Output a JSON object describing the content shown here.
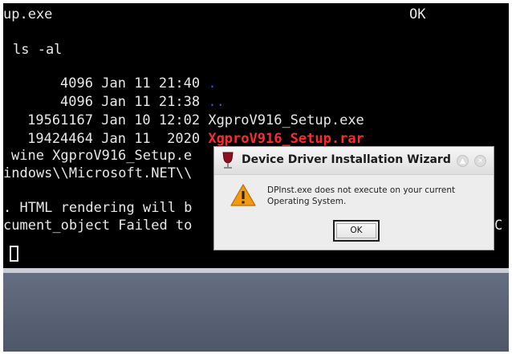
{
  "colors": {
    "terminal_bg": "#000000",
    "terminal_text": "#e8e8e8",
    "dir_blue": "#3b4cf0",
    "archive_red": "#ff2a2a",
    "desktop": "#565f70",
    "dialog_bg": "#ededed",
    "warning_orange": "#f29a12"
  },
  "terminal": {
    "lines": [
      {
        "left": "up.exe",
        "right": "OK"
      },
      {
        "text": "ls -al"
      },
      {
        "size": "4096",
        "date": "Jan 11 21:40",
        "name": "."
      },
      {
        "size": "4096",
        "date": "Jan 11 21:38",
        "name": ".."
      },
      {
        "size": "19561167",
        "date": "Jan 10 12:02",
        "name": "XgproV916_Setup.exe"
      },
      {
        "size": "19424464",
        "date": "Jan 11  2020",
        "name": "XgproV916_Setup.rar"
      },
      {
        "text": "wine XgproV916_Setup.e"
      },
      {
        "text": "indows\\\\Microsoft.NET\\\\"
      },
      {
        "left": ". HTML rendering will b",
        "right": ""
      },
      {
        "left": "cument_object Failed to",
        "right": "C"
      }
    ]
  },
  "dialog": {
    "title": "Device Driver Installation Wizard",
    "title_icon": "wine-glass-icon",
    "warning_icon": "warning-icon",
    "message_line1": "DPInst.exe does not execute on your current",
    "message_line2": "Operating System.",
    "ok_label": "OK",
    "titlebar_buttons": [
      "maximize-icon",
      "close-icon"
    ]
  }
}
